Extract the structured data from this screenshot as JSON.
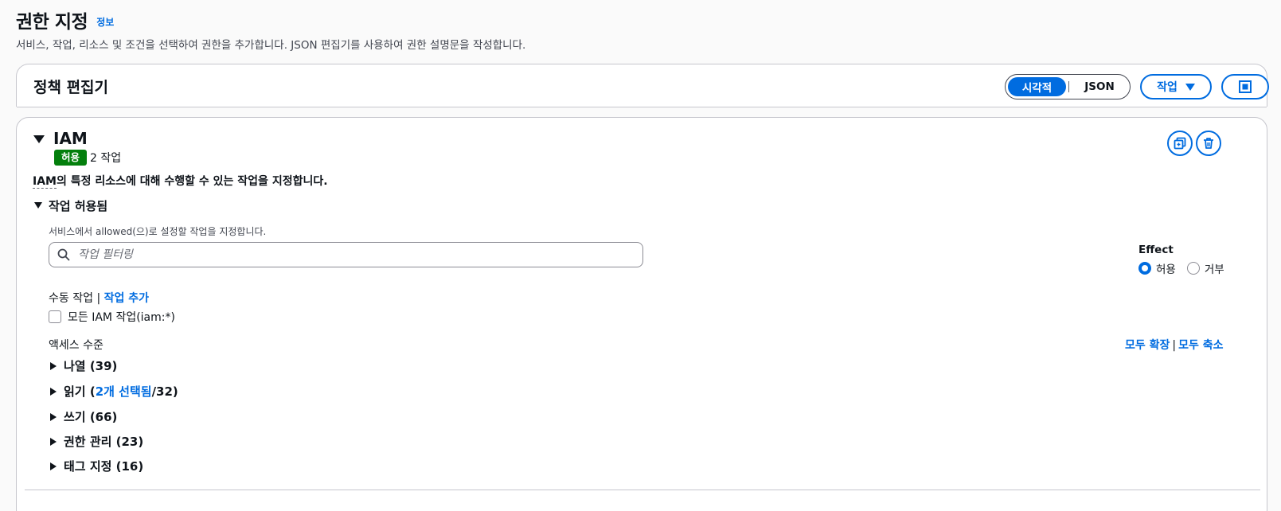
{
  "header": {
    "title": "권한 지정",
    "info_link": "정보",
    "description": "서비스, 작업, 리소스 및 조건을 선택하여 권한을 추가합니다. JSON 편집기를 사용하여 권한 설명문을 작성합니다."
  },
  "editor": {
    "title": "정책 편집기",
    "mode_visual": "시각적",
    "mode_json": "JSON",
    "selected_mode": "시각적",
    "actions_dropdown": "작업"
  },
  "statement": {
    "service": "IAM",
    "effect_badge": "허용",
    "action_count": "2 작업",
    "description_abbr": "IAM",
    "description_rest": "의 특정 리소스에 대해 수행할 수 있는 작업을 지정합니다.",
    "allowed_section": {
      "title": "작업 허용됨",
      "description": "서비스에서 allowed(으)로 설정할 작업을 지정합니다.",
      "filter_placeholder": "작업 필터링"
    },
    "effect": {
      "label": "Effect",
      "options": [
        "허용",
        "거부"
      ],
      "selected": "허용"
    },
    "manual": {
      "label": "수동 작업",
      "separator": "|",
      "add_link": "작업 추가",
      "all_actions_checkbox": "모든 IAM 작업(iam:*)",
      "all_actions_checked": false
    },
    "access_level": {
      "label": "액세스 수준",
      "expand_all": "모두 확장",
      "separator": "|",
      "collapse_all": "모두 축소",
      "groups": [
        {
          "label": "나열 (39)"
        },
        {
          "prefix": "읽기 (",
          "selected_link": "2개 선택됨",
          "suffix": "/32)"
        },
        {
          "label": "쓰기 (66)"
        },
        {
          "label": "권한 관리 (23)"
        },
        {
          "label": "태그 지정 (16)"
        }
      ]
    }
  },
  "colors": {
    "accent": "#006ce0",
    "allow_badge": "#037f0c",
    "text": "#0f141a",
    "border": "#c6c6cd"
  }
}
